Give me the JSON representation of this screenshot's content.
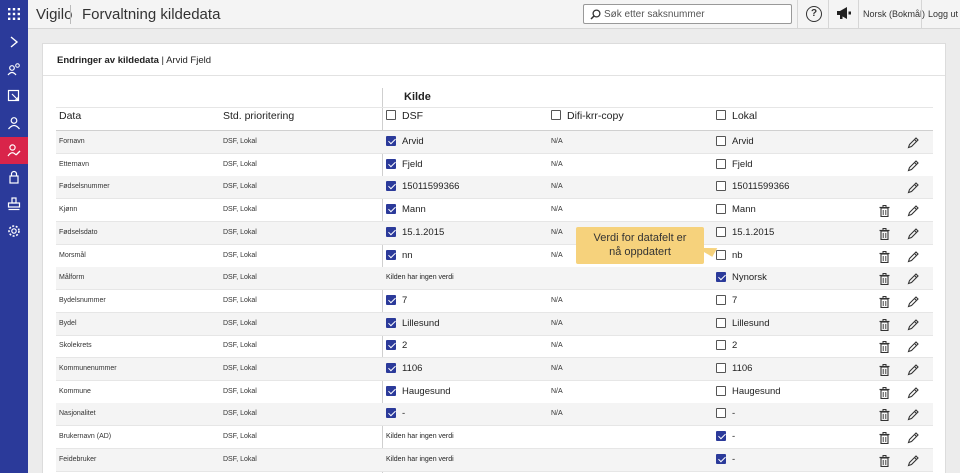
{
  "topbar": {
    "brand": "Vigilo",
    "app_title": "Forvaltning kildedata",
    "search_placeholder": "Søk etter saksnummer",
    "help": "?",
    "language": "Norsk (Bokmål)",
    "logout": "Logg ut"
  },
  "sidebar": {
    "items": [
      {
        "icon": "chevron-right-icon",
        "active": false
      },
      {
        "icon": "person-search-icon",
        "active": false
      },
      {
        "icon": "form-select-icon",
        "active": false
      },
      {
        "icon": "person-icon",
        "active": false
      },
      {
        "icon": "person-edit-icon",
        "active": true
      },
      {
        "icon": "lock-icon",
        "active": false
      },
      {
        "icon": "stamp-icon",
        "active": false
      },
      {
        "icon": "gear-icon",
        "active": false
      }
    ]
  },
  "card": {
    "title_bold": "Endringer av kildedata",
    "title_rest": " | Arvid Fjeld"
  },
  "table": {
    "kilde_label": "Kilde",
    "headers": {
      "data": "Data",
      "prio": "Std. prioritering",
      "dsf": "DSF",
      "difi": "Difi-krr-copy",
      "lokal": "Lokal"
    },
    "rows": [
      {
        "data": "Fornavn",
        "prio": "DSF, Lokal",
        "dsf": "Arvid",
        "dsf_checked": true,
        "difi": "N/A",
        "lokal": "Arvid",
        "lokal_checked": false,
        "trash": false
      },
      {
        "data": "Etternavn",
        "prio": "DSF, Lokal",
        "dsf": "Fjeld",
        "dsf_checked": true,
        "difi": "N/A",
        "lokal": "Fjeld",
        "lokal_checked": false,
        "trash": false
      },
      {
        "data": "Fødselsnummer",
        "prio": "DSF, Lokal",
        "dsf": "15011599366",
        "dsf_checked": true,
        "difi": "N/A",
        "lokal": "15011599366",
        "lokal_checked": false,
        "trash": false
      },
      {
        "data": "Kjønn",
        "prio": "DSF, Lokal",
        "dsf": "Mann",
        "dsf_checked": true,
        "difi": "N/A",
        "lokal": "Mann",
        "lokal_checked": false,
        "trash": true
      },
      {
        "data": "Fødselsdato",
        "prio": "DSF, Lokal",
        "dsf": "15.1.2015",
        "dsf_checked": true,
        "difi": "N/A",
        "lokal": "15.1.2015",
        "lokal_checked": false,
        "trash": true
      },
      {
        "data": "Morsmål",
        "prio": "DSF, Lokal",
        "dsf": "nn",
        "dsf_checked": true,
        "difi": "N/A",
        "lokal": "nb",
        "lokal_checked": false,
        "trash": true
      },
      {
        "data": "Målform",
        "prio": "DSF, Lokal",
        "dsf": null,
        "dsf_text": "Kilden har ingen verdi",
        "difi": "",
        "lokal": "Nynorsk",
        "lokal_checked": true,
        "trash": true
      },
      {
        "data": "Bydelsnummer",
        "prio": "DSF, Lokal",
        "dsf": "7",
        "dsf_checked": true,
        "difi": "N/A",
        "lokal": "7",
        "lokal_checked": false,
        "trash": true
      },
      {
        "data": "Bydel",
        "prio": "DSF, Lokal",
        "dsf": "Lillesund",
        "dsf_checked": true,
        "difi": "N/A",
        "lokal": "Lillesund",
        "lokal_checked": false,
        "trash": true
      },
      {
        "data": "Skolekrets",
        "prio": "DSF, Lokal",
        "dsf": "2",
        "dsf_checked": true,
        "difi": "N/A",
        "lokal": "2",
        "lokal_checked": false,
        "trash": true
      },
      {
        "data": "Kommunenummer",
        "prio": "DSF, Lokal",
        "dsf": "1106",
        "dsf_checked": true,
        "difi": "N/A",
        "lokal": "1106",
        "lokal_checked": false,
        "trash": true
      },
      {
        "data": "Kommune",
        "prio": "DSF, Lokal",
        "dsf": "Haugesund",
        "dsf_checked": true,
        "difi": "N/A",
        "lokal": "Haugesund",
        "lokal_checked": false,
        "trash": true
      },
      {
        "data": "Nasjonalitet",
        "prio": "DSF, Lokal",
        "dsf": "-",
        "dsf_checked": true,
        "difi": "N/A",
        "lokal": "-",
        "lokal_checked": false,
        "trash": true
      },
      {
        "data": "Brukernavn (AD)",
        "prio": "DSF, Lokal",
        "dsf": null,
        "dsf_text": "Kilden har ingen verdi",
        "difi": "",
        "lokal": "-",
        "lokal_checked": true,
        "trash": true
      },
      {
        "data": "Feidebruker",
        "prio": "DSF, Lokal",
        "dsf": null,
        "dsf_text": "Kilden har ingen verdi",
        "difi": "",
        "lokal": "-",
        "lokal_checked": true,
        "trash": true
      }
    ]
  },
  "tooltip": {
    "line1": "Verdi for datafelt er",
    "line2": "nå oppdatert"
  },
  "colors": {
    "brand_blue": "#2b3a9a",
    "active_red": "#d9244a",
    "tooltip_yellow": "#f6d27c"
  }
}
